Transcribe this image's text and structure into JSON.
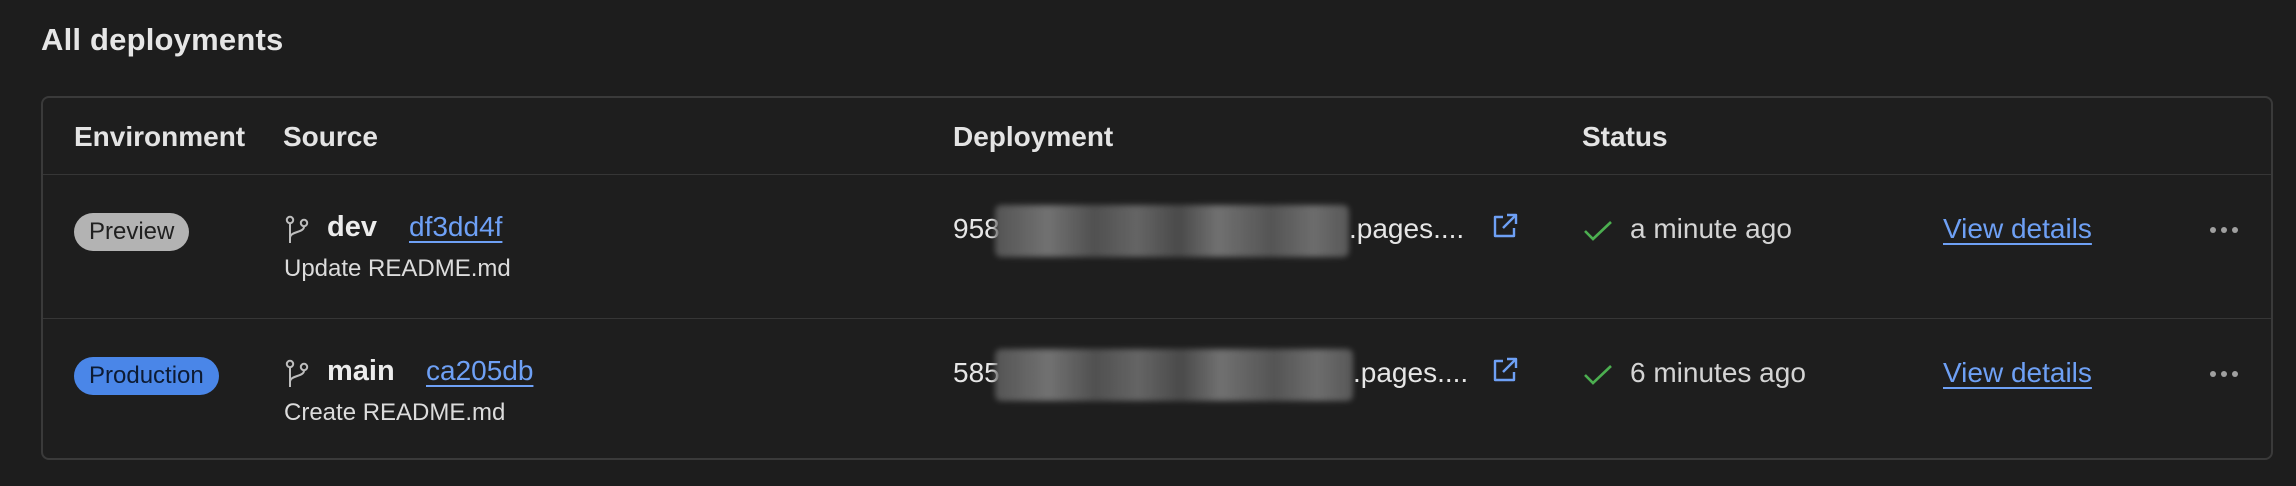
{
  "page": {
    "title": "All deployments"
  },
  "table": {
    "headers": {
      "environment": "Environment",
      "source": "Source",
      "deployment": "Deployment",
      "status": "Status"
    },
    "rows": [
      {
        "environment": "Preview",
        "environment_color": "#b3b3b3",
        "branch": "dev",
        "commit": "df3dd4f",
        "commit_message": "Update README.md",
        "deployment_prefix": "958",
        "deployment_suffix": ".pages....",
        "status_icon": "check-icon",
        "status": "a minute ago",
        "action": "View details"
      },
      {
        "environment": "Production",
        "environment_color": "#4a86e8",
        "branch": "main",
        "commit": "ca205db",
        "commit_message": "Create README.md",
        "deployment_prefix": "585",
        "deployment_suffix": ".pages....",
        "status_icon": "check-icon",
        "status": "6 minutes ago",
        "action": "View details"
      }
    ]
  },
  "colors": {
    "background": "#1d1d1d",
    "link": "#6ea0f5",
    "success": "#4caf50"
  }
}
